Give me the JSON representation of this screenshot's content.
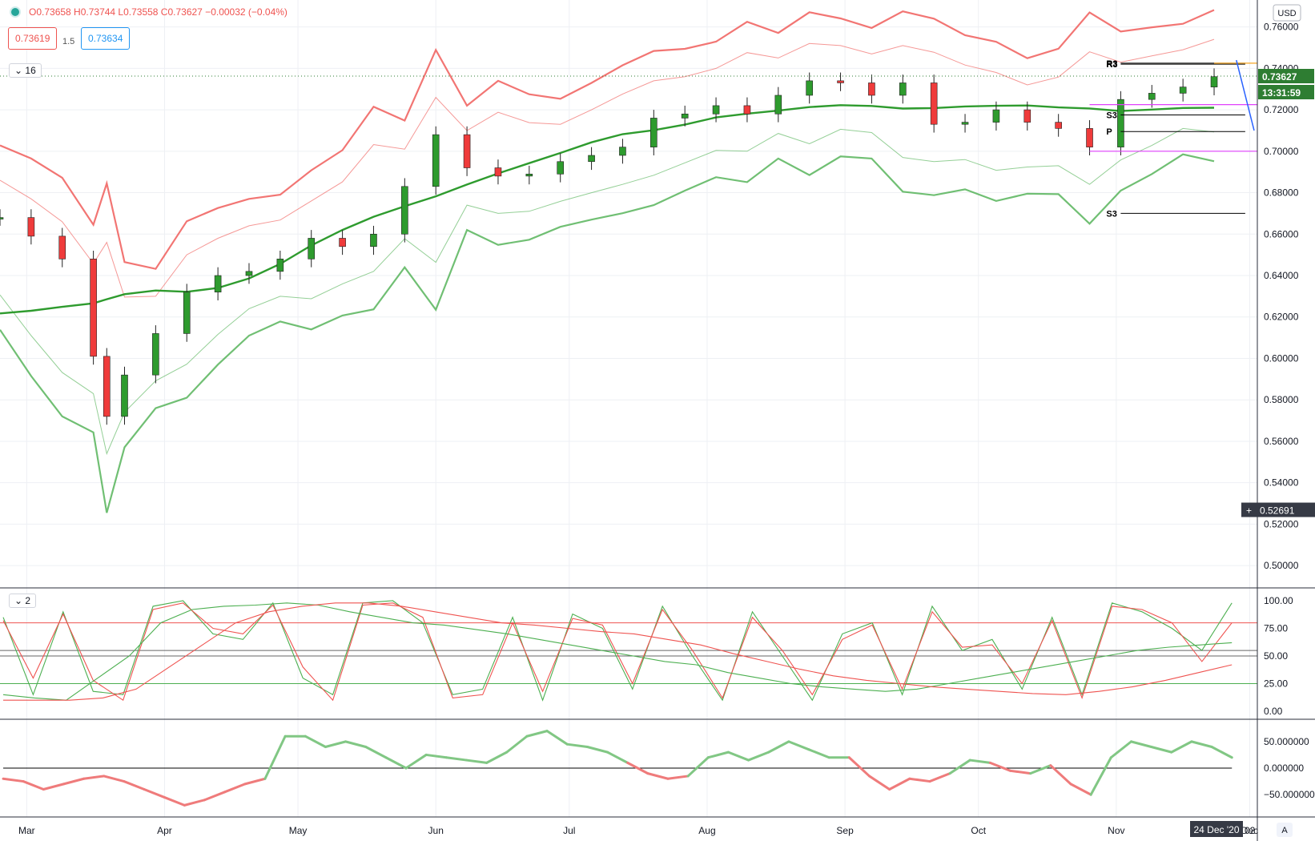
{
  "header": {
    "ohlc_text": "O0.73658 H0.73744 L0.73558 C0.73627 −0.00032 (−0.04%)",
    "bid": "0.73619",
    "spread": "1.5",
    "ask": "0.73634",
    "indicator_group_1": "16",
    "indicator_group_2": "2"
  },
  "price_axis": {
    "currency": "USD",
    "ticks": [
      "0.76000",
      "0.74000",
      "0.72000",
      "0.70000",
      "0.68000",
      "0.66000",
      "0.64000",
      "0.62000",
      "0.60000",
      "0.58000",
      "0.56000",
      "0.54000",
      "0.52000",
      "0.50000"
    ],
    "last_price": "0.73627",
    "countdown": "13:31:59",
    "crosshair_price": "0.52691"
  },
  "stoch_axis": {
    "ticks": [
      "100.00",
      "75.00",
      "50.00",
      "25.00",
      "0.00"
    ]
  },
  "momentum_axis": {
    "ticks": [
      "50.000000",
      "0.000000",
      "−50.000000"
    ]
  },
  "time_axis": {
    "labels": [
      "Mar",
      "Apr",
      "May",
      "Jun",
      "Jul",
      "Aug",
      "Sep",
      "Oct",
      "Nov",
      "Dec"
    ],
    "crosshair_date": "24 Dec '20",
    "right_stub": "02",
    "auto_button": "A"
  },
  "pivot_labels": [
    "R3",
    "R3",
    "S3",
    "P",
    "S3"
  ],
  "colors": {
    "up": "#2e9b2e",
    "down": "#ef3b3b",
    "upper_band": "#ef5350",
    "lower_band": "#4caf50",
    "orange": "#f5a623",
    "violet": "#e040fb",
    "blue": "#2962ff",
    "accent": "#2e7d32"
  },
  "chart_data": [
    {
      "type": "candlestick",
      "title": "",
      "xlabel": "",
      "ylabel": "",
      "ylim": [
        0.49,
        0.773
      ],
      "x_domain": [
        "2020-02-24",
        "2020-12-02"
      ],
      "series": [
        {
          "dates": [
            "2020-02-24",
            "2020-03-02",
            "2020-03-09",
            "2020-03-16",
            "2020-03-19",
            "2020-03-23",
            "2020-03-30",
            "2020-04-06",
            "2020-04-13",
            "2020-04-20",
            "2020-04-27",
            "2020-05-04",
            "2020-05-11",
            "2020-05-18",
            "2020-05-25",
            "2020-06-01",
            "2020-06-08",
            "2020-06-15",
            "2020-06-22",
            "2020-06-29",
            "2020-07-06",
            "2020-07-13",
            "2020-07-20",
            "2020-07-27",
            "2020-08-03",
            "2020-08-10",
            "2020-08-17",
            "2020-08-24",
            "2020-08-31",
            "2020-09-07",
            "2020-09-14",
            "2020-09-21",
            "2020-09-28",
            "2020-10-05",
            "2020-10-12",
            "2020-10-19",
            "2020-10-26",
            "2020-11-02",
            "2020-11-09",
            "2020-11-16",
            "2020-11-23"
          ],
          "values": [
            0.668,
            0.659,
            0.648,
            0.601,
            0.572,
            0.592,
            0.612,
            0.632,
            0.64,
            0.642,
            0.648,
            0.658,
            0.654,
            0.66,
            0.683,
            0.708,
            0.692,
            0.688,
            0.689,
            0.695,
            0.698,
            0.702,
            0.716,
            0.718,
            0.722,
            0.718,
            0.727,
            0.734,
            0.733,
            0.727,
            0.733,
            0.713,
            0.714,
            0.72,
            0.714,
            0.711,
            0.702,
            0.725,
            0.728,
            0.731,
            0.736
          ]
        }
      ],
      "pivots": [
        {
          "label": "R3",
          "value": 0.7425
        },
        {
          "label": "R3",
          "value": 0.742
        },
        {
          "label": "S3",
          "value": 0.7175
        },
        {
          "label": "P",
          "value": 0.7095
        },
        {
          "label": "S3",
          "value": 0.67
        }
      ]
    },
    {
      "type": "line",
      "title": "",
      "ylim": [
        0,
        100
      ],
      "levels": [
        80,
        55,
        50,
        25
      ],
      "series": [
        {
          "values": [
            85,
            15,
            90,
            18,
            15,
            95,
            100,
            70,
            65,
            98,
            30,
            15,
            98,
            100,
            80,
            15,
            20,
            85,
            10,
            88,
            75,
            20,
            95,
            50,
            10,
            90,
            50,
            10,
            70,
            80,
            15,
            95,
            55,
            65,
            20,
            85,
            15,
            98,
            90,
            75,
            55,
            98
          ]
        },
        {
          "values": [
            82,
            30,
            88,
            28,
            10,
            92,
            98,
            75,
            70,
            96,
            40,
            10,
            96,
            98,
            85,
            12,
            15,
            80,
            18,
            84,
            78,
            25,
            92,
            55,
            12,
            85,
            55,
            15,
            65,
            78,
            20,
            90,
            58,
            60,
            25,
            82,
            12,
            95,
            92,
            80,
            45,
            80
          ]
        },
        {
          "values": [
            15,
            12,
            10,
            30,
            50,
            80,
            92,
            95,
            96,
            98,
            96,
            90,
            85,
            80,
            78,
            74,
            70,
            65,
            60,
            55,
            50,
            45,
            42,
            35,
            30,
            25,
            22,
            20,
            18,
            20,
            25,
            30,
            35,
            40,
            45,
            50,
            55,
            58,
            60,
            62
          ]
        },
        {
          "values": [
            10,
            10,
            10,
            12,
            20,
            40,
            60,
            80,
            90,
            95,
            98,
            98,
            95,
            90,
            85,
            80,
            78,
            75,
            72,
            70,
            65,
            60,
            52,
            45,
            38,
            32,
            28,
            25,
            22,
            20,
            18,
            16,
            15,
            18,
            22,
            28,
            35,
            42
          ]
        }
      ]
    },
    {
      "type": "line",
      "title": "",
      "ylim": [
        -80,
        80
      ],
      "series": [
        {
          "values": [
            -20,
            -25,
            -40,
            -30,
            -20,
            -15,
            -25,
            -40,
            -55,
            -70,
            -60,
            -45,
            -30,
            -20,
            60,
            60,
            40,
            50,
            40,
            20,
            0,
            25,
            20,
            15,
            10,
            30,
            60,
            70,
            45,
            40,
            30,
            10,
            -10,
            -20,
            -15,
            20,
            30,
            15,
            30,
            50,
            35,
            20,
            20,
            -15,
            -40,
            -20,
            -25,
            -10,
            15,
            10,
            -5,
            -10,
            5,
            -30,
            -50,
            20,
            50,
            40,
            30,
            50,
            40,
            20
          ]
        }
      ]
    }
  ]
}
